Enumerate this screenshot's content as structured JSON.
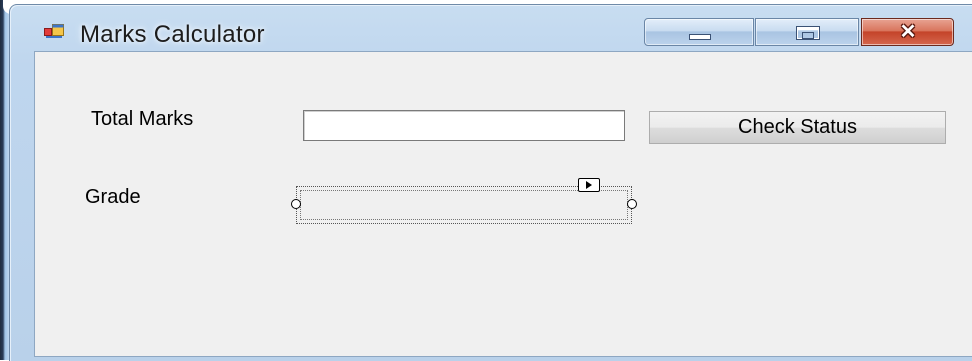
{
  "window": {
    "title": "Marks Calculator",
    "icon": "winforms-app-icon",
    "controls": {
      "minimize": "minimize-icon",
      "maximize": "maximize-icon",
      "close_glyph": "✕"
    }
  },
  "form": {
    "total_marks_label": "Total Marks",
    "total_marks_value": "",
    "check_status_label": "Check Status",
    "grade_label": "Grade",
    "grade_value": ""
  },
  "colors": {
    "client_background": "#f0f0f0",
    "close_button": "#c4442a",
    "frame": "#bfd6ee"
  }
}
